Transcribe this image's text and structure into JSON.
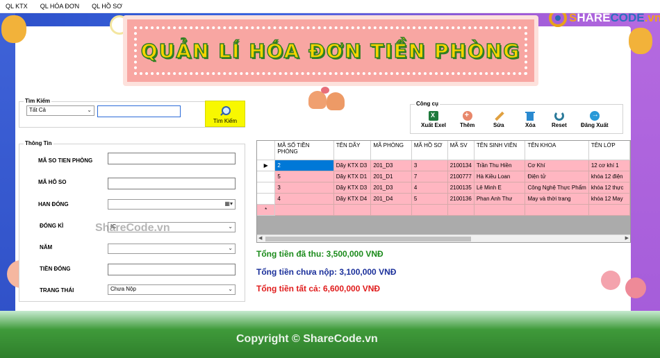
{
  "menu": [
    {
      "label": "QL KTX"
    },
    {
      "label": "QL HÓA ĐƠN"
    },
    {
      "label": "QL HỒ SƠ"
    }
  ],
  "banner": {
    "title": "QUẢN LÍ HÓA ĐƠN TIỀN PHÒNG"
  },
  "logo": {
    "s": "S",
    "mid": "HARE",
    "c": "CODE",
    "vn": ".vn"
  },
  "search": {
    "title": "Tìm Kiếm",
    "filter_value": "Tất Cả",
    "query_value": "",
    "button_label": "Tìm Kiếm"
  },
  "info": {
    "title": "Thông Tin",
    "fields": [
      {
        "label": "MÃ SO TIEN PHÒNG",
        "value": ""
      },
      {
        "label": "MÃ HÔ SO",
        "value": ""
      },
      {
        "label": "HAN ĐÓNG",
        "value": ""
      },
      {
        "label": "ĐÓNG KÌ",
        "value": "IC"
      },
      {
        "label": "NĂM",
        "value": ""
      },
      {
        "label": "TIỀN ĐÓNG",
        "value": ""
      },
      {
        "label": "TRANG THÁI",
        "value": "Chưa Nộp"
      }
    ]
  },
  "tools": {
    "title": "Công cụ",
    "items": [
      {
        "label": "Xuất Exel",
        "icon": "excel-icon"
      },
      {
        "label": "Thêm",
        "icon": "add-icon"
      },
      {
        "label": "Sửa",
        "icon": "edit-icon"
      },
      {
        "label": "Xóa",
        "icon": "trash-icon"
      },
      {
        "label": "Reset",
        "icon": "reset-icon"
      },
      {
        "label": "Đăng Xuất",
        "icon": "logout-icon"
      }
    ]
  },
  "grid": {
    "columns": [
      "MÃ SỐ TIỀN PHÒNG",
      "TÊN DÃY",
      "MÃ PHÒNG",
      "MÃ HỒ SƠ",
      "MÃ SV",
      "TÊN SINH VIÊN",
      "TÊN KHOA",
      "TÊN LỚP"
    ],
    "rows": [
      [
        "2",
        "Dãy KTX D3",
        "201_D3",
        "3",
        "2100134",
        "Trần Thu Hiền",
        "Cơ Khí",
        "12 cơ khí 1"
      ],
      [
        "5",
        "Dãy KTX D1",
        "201_D1",
        "7",
        "2100777",
        "Hà Kiều Loan",
        "Điện tử",
        "khóa 12 điện"
      ],
      [
        "3",
        "Dãy KTX D3",
        "201_D3",
        "4",
        "2100135",
        "Lê Minh E",
        "Công Nghệ Thực Phẩm",
        "khóa 12 thực"
      ],
      [
        "4",
        "Dãy KTX D4",
        "201_D4",
        "5",
        "2100136",
        "Phan Anh Thư",
        "May và thời trang",
        "khóa 12 May"
      ]
    ],
    "new_row_marker": "*",
    "current_row_marker": "▶"
  },
  "totals": {
    "paid": "Tổng tiền đã thu: 3,500,000 VNĐ",
    "unpaid": "Tổng tiền chưa nộp: 3,100,000 VNĐ",
    "all": "Tổng tiền tất cả: 6,600,000 VNĐ"
  },
  "colors": {
    "paid": "#1a8a1a",
    "unpaid": "#1a2f9a",
    "all": "#e01b1b",
    "row": "#ffb6c1",
    "selected": "#0078d7"
  },
  "watermarks": {
    "center": "ShareCode.vn",
    "footer": "Copyright © ShareCode.vn"
  }
}
